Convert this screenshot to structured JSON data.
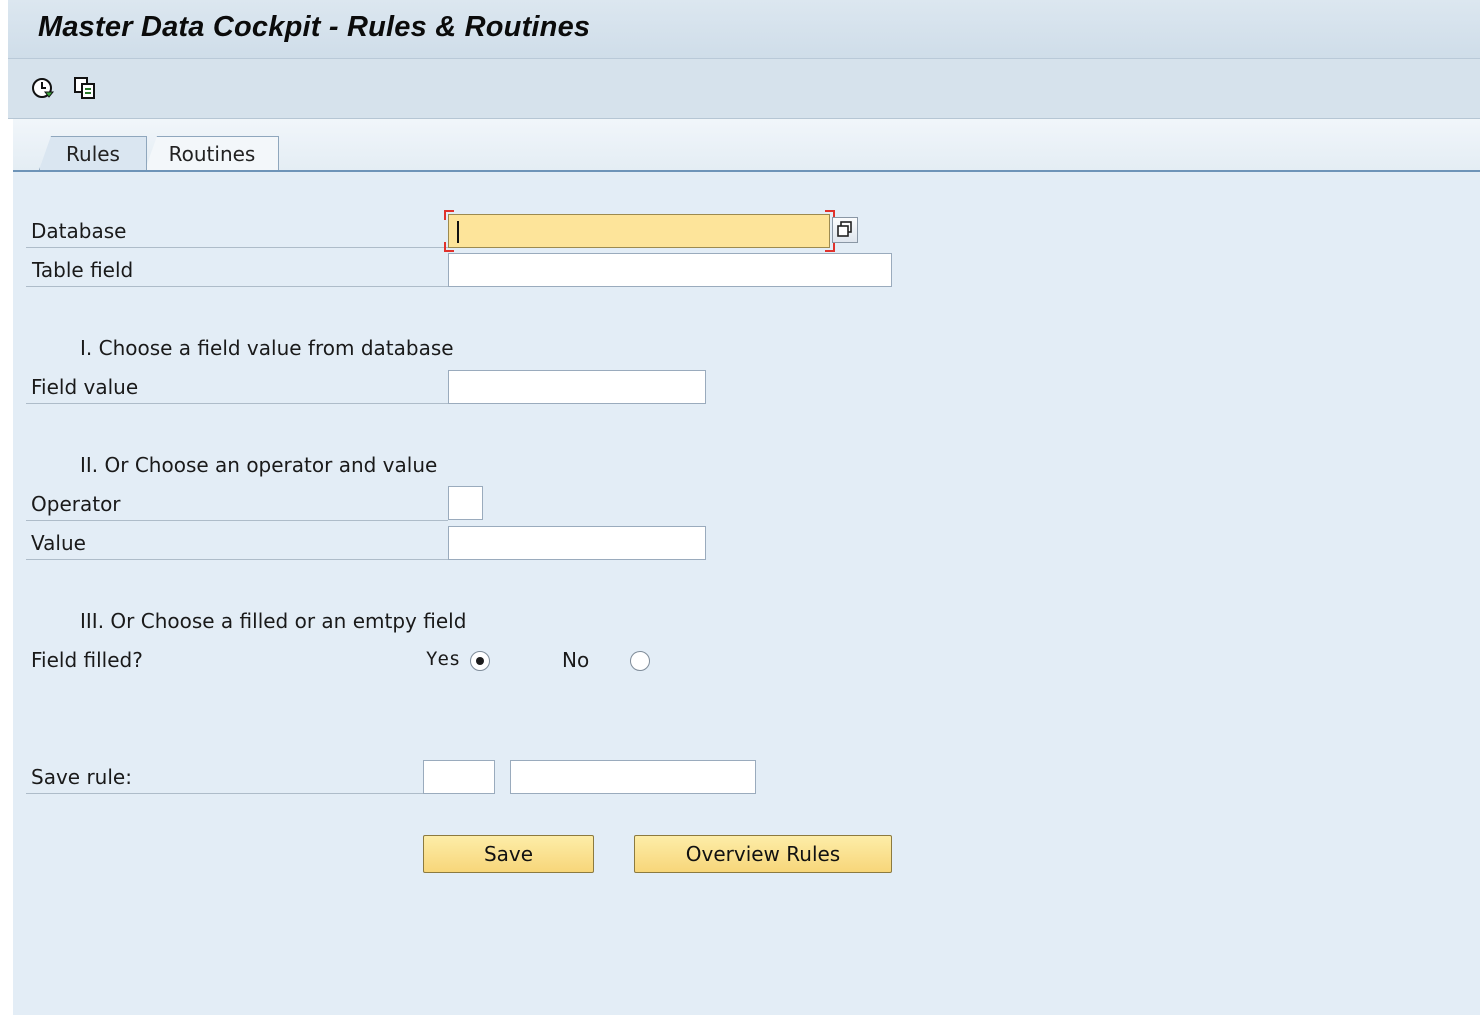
{
  "window": {
    "title": "Master Data Cockpit - Rules & Routines"
  },
  "toolbar": {
    "icons": [
      "execute-icon",
      "copy-icon"
    ]
  },
  "tabs": [
    {
      "label": "Rules",
      "active": true
    },
    {
      "label": "Routines",
      "active": false
    }
  ],
  "form": {
    "database": {
      "label": "Database",
      "value": ""
    },
    "table_field": {
      "label": "Table field",
      "value": ""
    },
    "section1": "I. Choose a field value from database",
    "field_value": {
      "label": "Field value",
      "value": ""
    },
    "section2": "II. Or Choose an operator and value",
    "operator": {
      "label": "Operator",
      "value": ""
    },
    "value": {
      "label": "Value",
      "value": ""
    },
    "section3": "III. Or Choose a filled or an emtpy field",
    "field_filled": {
      "label": "Field filled?",
      "yes_label": "Yes",
      "no_label": "No",
      "selected": "Yes"
    },
    "save_rule": {
      "label": "Save rule:",
      "value1": "",
      "value2": ""
    }
  },
  "buttons": {
    "save": "Save",
    "overview": "Overview Rules"
  }
}
